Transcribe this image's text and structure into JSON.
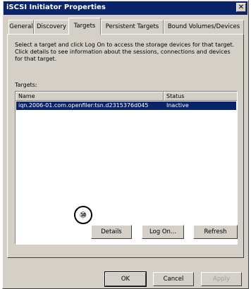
{
  "window": {
    "title": "iSCSI Initiator Properties",
    "close_glyph": "✕"
  },
  "tabs": [
    {
      "label": "General",
      "active": false
    },
    {
      "label": "Discovery",
      "active": false
    },
    {
      "label": "Targets",
      "active": true
    },
    {
      "label": "Persistent Targets",
      "active": false
    },
    {
      "label": "Bound Volumes/Devices",
      "active": false
    }
  ],
  "panel": {
    "instructions": "Select a target and click Log On to access the storage devices for that target. Click details to see information about the sessions, connections and devices for that target.",
    "targets_label": "Targets:",
    "columns": {
      "name": "Name",
      "status": "Status"
    },
    "rows": [
      {
        "name": "iqn.2006-01.com.openfiler:tsn.d2315376d045",
        "status": "Inactive",
        "selected": true
      }
    ],
    "annotation_marker": "⑩",
    "buttons": {
      "details": "Details",
      "logon": "Log On...",
      "refresh": "Refresh"
    }
  },
  "dialog_buttons": {
    "ok": "OK",
    "cancel": "Cancel",
    "apply": "Apply"
  },
  "colors": {
    "title_bar": "#0a246a",
    "selection": "#0a246a",
    "face": "#d4d0c8"
  },
  "icons": {
    "close": "close-icon"
  }
}
